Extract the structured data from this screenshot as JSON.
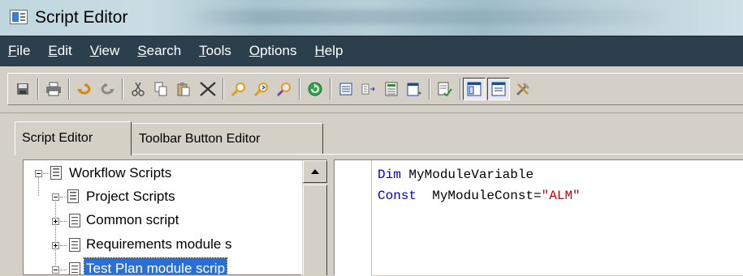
{
  "window": {
    "title": "Script Editor",
    "background_title_blurred": true
  },
  "menu": {
    "items": [
      {
        "label": "File",
        "ul": "F",
        "rest": "ile"
      },
      {
        "label": "Edit",
        "ul": "E",
        "rest": "dit"
      },
      {
        "label": "View",
        "ul": "V",
        "rest": "iew"
      },
      {
        "label": "Search",
        "ul": "S",
        "rest": "earch"
      },
      {
        "label": "Tools",
        "ul": "T",
        "rest": "ools"
      },
      {
        "label": "Options",
        "ul": "O",
        "rest": "ptions"
      },
      {
        "label": "Help",
        "ul": "H",
        "rest": "elp"
      }
    ]
  },
  "toolbar": {
    "buttons": [
      "save-icon",
      "print-icon",
      "undo-icon",
      "redo-icon",
      "cut-icon",
      "copy-icon",
      "paste-icon",
      "delete-icon",
      "find-icon",
      "find-next-icon",
      "replace-icon",
      "refresh-icon",
      "list-icon",
      "list-alt-icon",
      "document-icon",
      "page-icon",
      "syntax-check-icon",
      "toggle-tree-icon",
      "toggle-output-icon",
      "tools-icon"
    ],
    "pressed": [
      "toggle-tree-icon",
      "toggle-output-icon"
    ]
  },
  "tabs": [
    {
      "label": "Script Editor",
      "active": true
    },
    {
      "label": "Toolbar Button Editor",
      "active": false
    }
  ],
  "tree": {
    "items": [
      {
        "label": "Workflow Scripts",
        "level": 0,
        "expanded": true
      },
      {
        "label": "Project Scripts",
        "level": 1,
        "expanded": true
      },
      {
        "label": "Common script",
        "level": 2,
        "expanded": false
      },
      {
        "label": "Requirements module s",
        "level": 2,
        "expanded": false
      },
      {
        "label": "Test Plan module scrip",
        "level": 2,
        "expanded": true,
        "selected": true
      }
    ]
  },
  "editor": {
    "lines": [
      {
        "keyword": "Dim",
        "rest": " MyModuleVariable",
        "string": ""
      },
      {
        "keyword": "Const",
        "rest": "  MyModuleConst=",
        "string": "\"ALM\""
      }
    ]
  },
  "colors": {
    "menubar_bg": "#2b3f4d",
    "keyword": "#0000c8",
    "string": "#c80000",
    "selection": "#2a6fd6",
    "chrome": "#d4d0c8"
  }
}
